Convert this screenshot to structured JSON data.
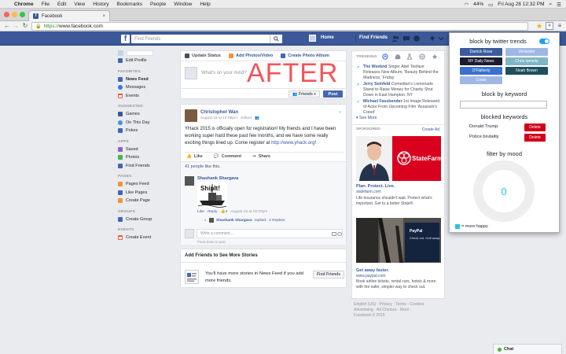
{
  "mac_menu": {
    "app": "Chrome",
    "items": [
      "File",
      "Edit",
      "View",
      "History",
      "Bookmarks",
      "People",
      "Window",
      "Help"
    ],
    "battery": "44%",
    "datetime": "Fri Aug 28  12:32 PM"
  },
  "browser": {
    "tab_title": "Facebook",
    "url_scheme": "https://",
    "url_host": "www.facebook.com",
    "extension_badge": "#"
  },
  "fb_header": {
    "logo": "f",
    "search_placeholder": "Find Friends",
    "home": "Home",
    "find_friends": "Find Friends"
  },
  "left_nav": {
    "edit_profile": "Edit Profile",
    "favorites_head": "FAVORITES",
    "favorites": [
      "News Feed",
      "Messages",
      "Events"
    ],
    "suggested_head": "SUGGESTED",
    "suggested": [
      "Games",
      "On This Day",
      "Pokes"
    ],
    "apps_head": "APPS",
    "apps": [
      "Saved",
      "Photos",
      "Find Friends"
    ],
    "pages_head": "PAGES",
    "pages": [
      "Pages Feed",
      "Like Pages",
      "Create Page"
    ],
    "groups_head": "GROUPS",
    "groups": [
      "Create Group"
    ],
    "events_head": "EVENTS",
    "events": [
      "Create Event"
    ]
  },
  "composer": {
    "update_status": "Update Status",
    "add_photos": "Add Photos/Video",
    "create_album": "Create Photo Album",
    "placeholder": "What's on your mind?",
    "overlay": "AFTER",
    "audience": "Friends",
    "post": "Post"
  },
  "post": {
    "author": "Christopher Wan",
    "meta": "August 19 at 10:08pm · Edited ·",
    "text": "YHack 2015 is officially open for registration! My friends and I have been working super hard these past few months, and we have some really exciting things lined up. Come register at ",
    "link": "http://www.yhack.org",
    "text_end": "!",
    "like": "Like",
    "comment": "Comment",
    "share": "Share",
    "likes_count": "41 people",
    "likes_suffix": " like this.",
    "comment_author": "Shashank Shargava",
    "comment_image_text": "ShipIt!",
    "comment_like": "Like",
    "comment_reply": "Reply",
    "comment_count": "4",
    "comment_time": "August 19 at 10:37pm",
    "reply_author": "Shashank Shargava",
    "reply_text": " replied · 2 Replies",
    "comment_placeholder": "Write a comment...",
    "comment_hint": "Press Enter to post."
  },
  "add_friends": {
    "title": "Add Friends to See More Stories",
    "text": "You'll have more stories in News Feed if you add more friends.",
    "button": "Find Friends"
  },
  "right_col": {
    "trending_head": "TRENDING",
    "trends": [
      {
        "name": "The Weeknd",
        "desc": "Singer Abel Tesfaye Releases New Album, 'Beauty Behind the Madness,' Friday"
      },
      {
        "name": "Jerry Seinfeld",
        "desc": "Comedian's Lemonade Stand to Raise Money for Charity Shut Down in East Hampton, NY"
      },
      {
        "name": "Michael Fassbender",
        "desc": "1st Image Released of Actor From Upcoming Film 'Assassin's Creed'"
      }
    ],
    "see_more": "See More",
    "sponsored": "SPONSORED",
    "create_ad": "Create Ad",
    "ad1": {
      "brand": "StateFarm",
      "title": "Plan. Protect. Live.",
      "url": "statefarm.com",
      "desc": "Life insurance shouldn't wait. Protect what's important. Get to a better State®."
    },
    "ad2": {
      "brand": "PayPal",
      "overlay": "Check out. Golf away.",
      "title": "Get away faster.",
      "url": "www.paypal.com",
      "desc": "Book airline tickets, rental cars, hotels & more with the safer, simpler way to check out."
    }
  },
  "footer": {
    "line1": "English (US) · Privacy · Terms · Cookies ·",
    "line2": "Advertising · Ad Choices · More ·",
    "line3": "Facebook © 2015"
  },
  "popup": {
    "twitter_title": "block by twitter trends",
    "chips": [
      {
        "label": "Darrick Rose",
        "color": "#3b5b9c"
      },
      {
        "label": "Verlander",
        "color": "#9fb7e6"
      },
      {
        "label": "NY Daily News",
        "color": "#1c1c30"
      },
      {
        "label": "Chris Iamelia",
        "color": "#7fb5c4"
      },
      {
        "label": "O'Flaherty",
        "color": "#3c6fd0"
      },
      {
        "label": "Noah Brown",
        "color": "#1f4f5f"
      },
      {
        "label": "Coats",
        "color": "#9fb7e6"
      }
    ],
    "keyword_title": "block by keyword",
    "blocked_title": "blocked keywords",
    "blocked": [
      "Donald Trump",
      "Police brutality"
    ],
    "delete": "Delete",
    "mood_title": "filter by mood",
    "mood_value": "0",
    "mood_legend": "= more happy"
  },
  "chat": {
    "label": "Chat"
  }
}
